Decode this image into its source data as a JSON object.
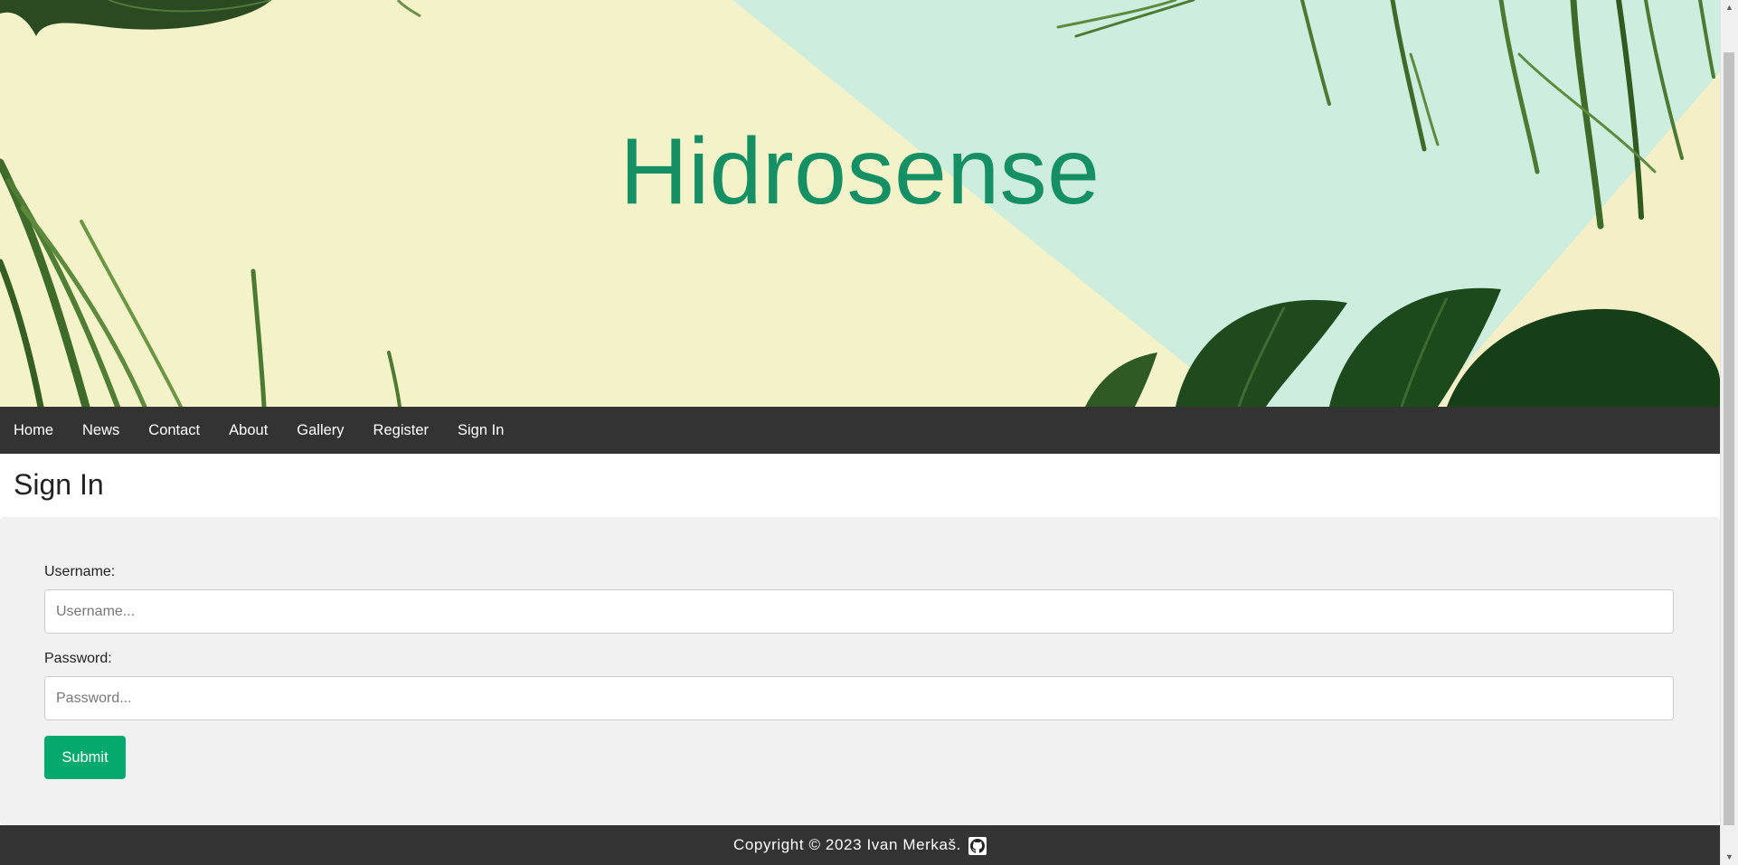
{
  "banner": {
    "title": "Hidrosense"
  },
  "nav": {
    "items": [
      {
        "label": "Home"
      },
      {
        "label": "News"
      },
      {
        "label": "Contact"
      },
      {
        "label": "About"
      },
      {
        "label": "Gallery"
      },
      {
        "label": "Register"
      },
      {
        "label": "Sign In"
      }
    ]
  },
  "page": {
    "title": "Sign In"
  },
  "form": {
    "username_label": "Username:",
    "username_placeholder": "Username...",
    "username_value": "",
    "password_label": "Password:",
    "password_placeholder": "Password...",
    "password_value": "",
    "submit_label": "Submit"
  },
  "footer": {
    "copyright": "Copyright © 2023 Ivan Merkaš.",
    "github_icon": "github-icon"
  },
  "colors": {
    "title_green": "#168f64",
    "navbar_bg": "#333333",
    "submit_bg": "#04aa6d",
    "form_bg": "#f1f1f1",
    "banner_yellow": "#f4f2c9",
    "banner_mint": "#cdeedf"
  }
}
